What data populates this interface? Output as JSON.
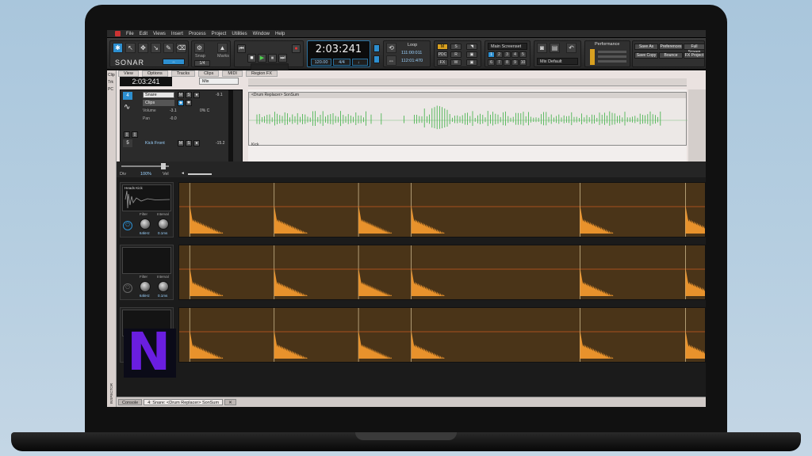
{
  "menu": [
    "File",
    "Edit",
    "Views",
    "Insert",
    "Process",
    "Project",
    "Utilities",
    "Window",
    "Help"
  ],
  "control_bar": {
    "logo": "SONAR",
    "tools": [
      {
        "name": "Smart",
        "label": "Smart"
      },
      {
        "name": "Select",
        "label": "Select"
      },
      {
        "name": "Move",
        "label": "Move"
      },
      {
        "name": "Edit",
        "label": "Edit"
      },
      {
        "name": "Draw",
        "label": "Draw"
      },
      {
        "name": "Erase",
        "label": "Erase"
      }
    ],
    "snap_label": "Snap",
    "marks_label": "Marks",
    "snap_value": "1/4",
    "now_time": "2:03:241",
    "tempo": "120.00",
    "meter": "4/4",
    "loop_label": "Loop",
    "loop_start": "111:00:011",
    "loop_end": "112:01:470",
    "screenset": "Main Screenset",
    "screenset_numbers": [
      "1",
      "2",
      "3",
      "4",
      "5",
      "6",
      "7",
      "8",
      "9",
      "10"
    ],
    "mix_default": "Mix Default",
    "performance_label": "Performance",
    "buttons": [
      "Save As",
      "Preferences",
      "Full Screen",
      "Save Copy",
      "Bounce",
      "FX Project"
    ]
  },
  "track_view": {
    "menu": [
      "View",
      "Options",
      "Tracks",
      "Clips",
      "MIDI",
      "Region FX"
    ],
    "time": "2:03:241",
    "mode": "Mix",
    "tracks": [
      {
        "number": "4",
        "name": "Snare",
        "clips_mode": "Clips",
        "volume": "-3.1",
        "pan": "0% C",
        "gain_lbl": "Volume",
        "pan_lbl": "Pan",
        "level": "-9.1",
        "db": "-0.0"
      },
      {
        "number": "5",
        "name": "Kick Front",
        "level": "-15.2"
      }
    ],
    "clip_title": "<Drum Replacer> SonSum",
    "clip_footer": "Kick"
  },
  "drum_replacer": {
    "div_label": "Div",
    "zoom": "100%",
    "view_label": "Vel",
    "lanes": [
      {
        "name": "Heads Kick",
        "filter_label": "Filter",
        "filter": "64kHz",
        "interval_label": "Interval",
        "interval": "0.1ms"
      },
      {
        "name": "",
        "filter_label": "Filter",
        "filter": "64kHz",
        "interval_label": "Interval",
        "interval": "0.1ms"
      },
      {
        "name": "",
        "filter_label": "Filter",
        "filter": "64kHz",
        "interval_label": "Interval",
        "interval": "0.1ms"
      }
    ],
    "hits": [
      0.02,
      0.18,
      0.34,
      0.44,
      0.76,
      0.96
    ]
  },
  "tabs": [
    "Console",
    "4: Snare: <Drum Replacer> SonSum"
  ],
  "side_tabs": [
    "Clip",
    "Trk",
    "PC"
  ],
  "inspector_label": "INSPECTOR",
  "overlay_logo": "N",
  "colors": {
    "accent": "#2d8fd0",
    "waveform": "#e8922c",
    "lane_bg": "#4a3418",
    "track_wave": "#3cb043"
  }
}
